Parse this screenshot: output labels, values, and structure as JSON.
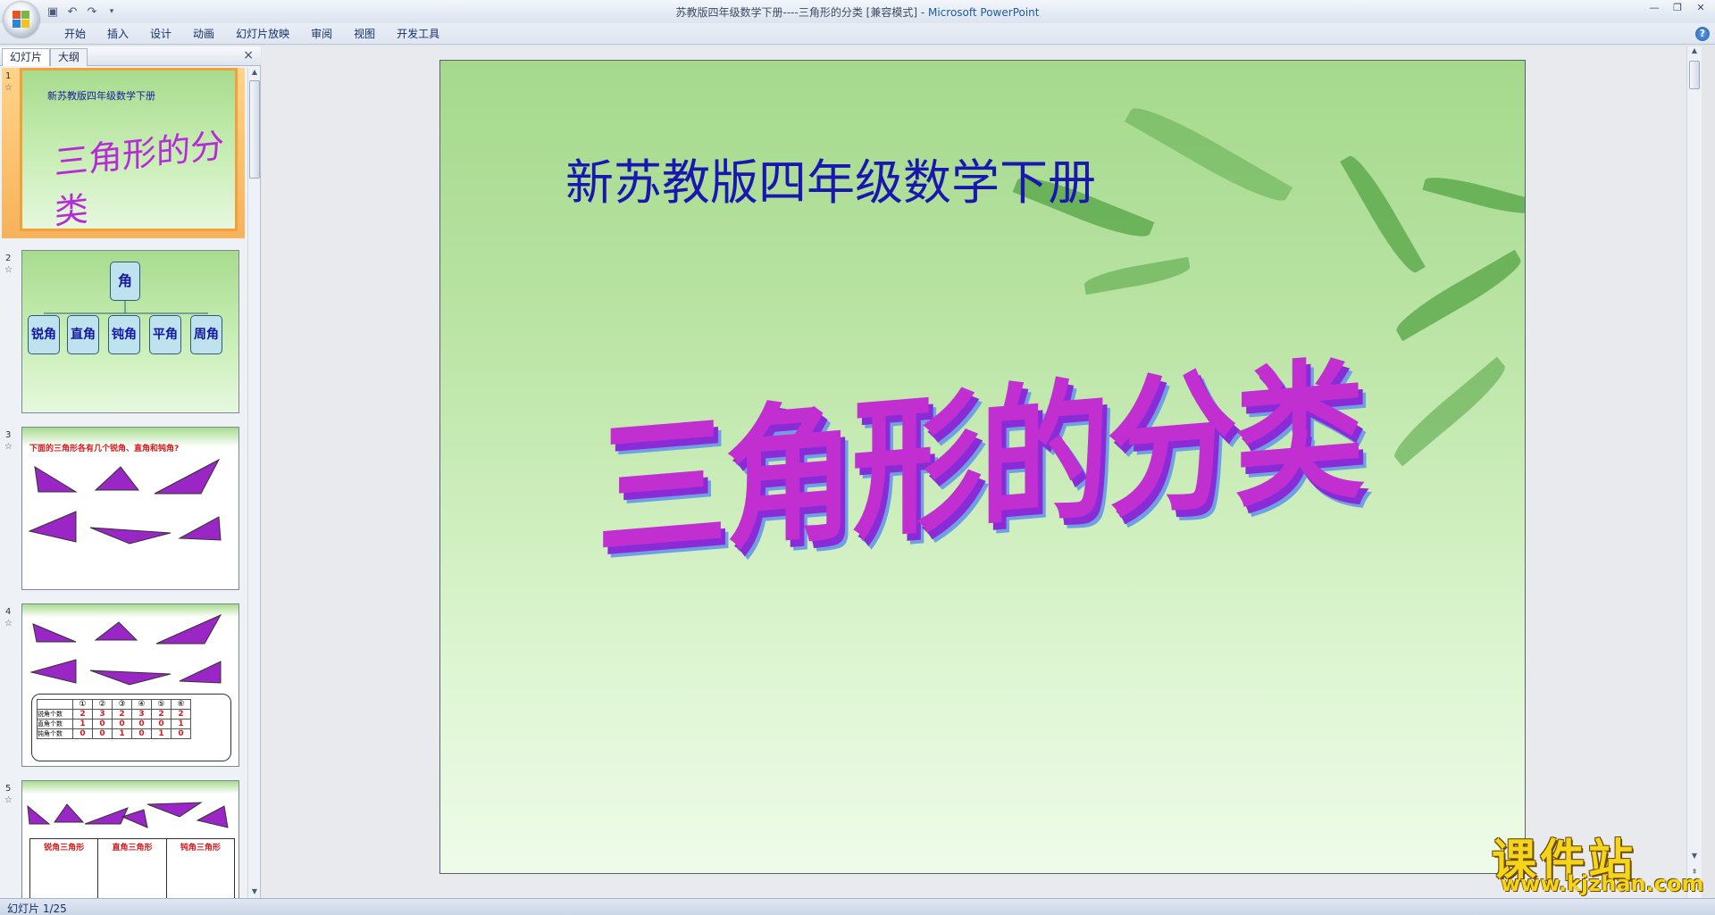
{
  "window": {
    "title_doc": "苏教版四年级数学下册----三角形的分类 [兼容模式] - ",
    "title_app": "Microsoft PowerPoint"
  },
  "quick_access": {
    "icons": [
      "save-icon",
      "undo-icon",
      "redo-icon",
      "customize-icon"
    ]
  },
  "ribbon": {
    "tabs": [
      "开始",
      "插入",
      "设计",
      "动画",
      "幻灯片放映",
      "审阅",
      "视图",
      "开发工具"
    ]
  },
  "pane": {
    "tab_slides": "幻灯片",
    "tab_outline": "大纲",
    "close": "×"
  },
  "thumbnails": [
    {
      "num": "1",
      "subtitle": "新苏教版四年级数学下册",
      "title": "三角形的分类"
    },
    {
      "num": "2",
      "root": "角",
      "children": [
        "锐角",
        "直角",
        "钝角",
        "平角",
        "周角"
      ]
    },
    {
      "num": "3",
      "heading": "下面的三角形各有几个锐角、直角和钝角?"
    },
    {
      "num": "4",
      "table_headers": [
        "①",
        "②",
        "③",
        "④",
        "⑤",
        "⑥"
      ],
      "row_labels": [
        "锐角个数",
        "直角个数",
        "钝角个数"
      ],
      "rows": [
        [
          "2",
          "3",
          "2",
          "3",
          "2",
          "2"
        ],
        [
          "1",
          "0",
          "0",
          "0",
          "0",
          "1"
        ],
        [
          "0",
          "0",
          "1",
          "0",
          "1",
          "0"
        ]
      ]
    },
    {
      "num": "5",
      "columns": [
        "锐角三角形",
        "直角三角形",
        "钝角三角形"
      ]
    }
  ],
  "slide": {
    "subtitle": "新苏教版四年级数学下册",
    "title": "三角形的分类"
  },
  "status": {
    "text": "幻灯片 1/25"
  },
  "watermark": {
    "main": "课件站",
    "url": "www.kjzhan.com"
  }
}
